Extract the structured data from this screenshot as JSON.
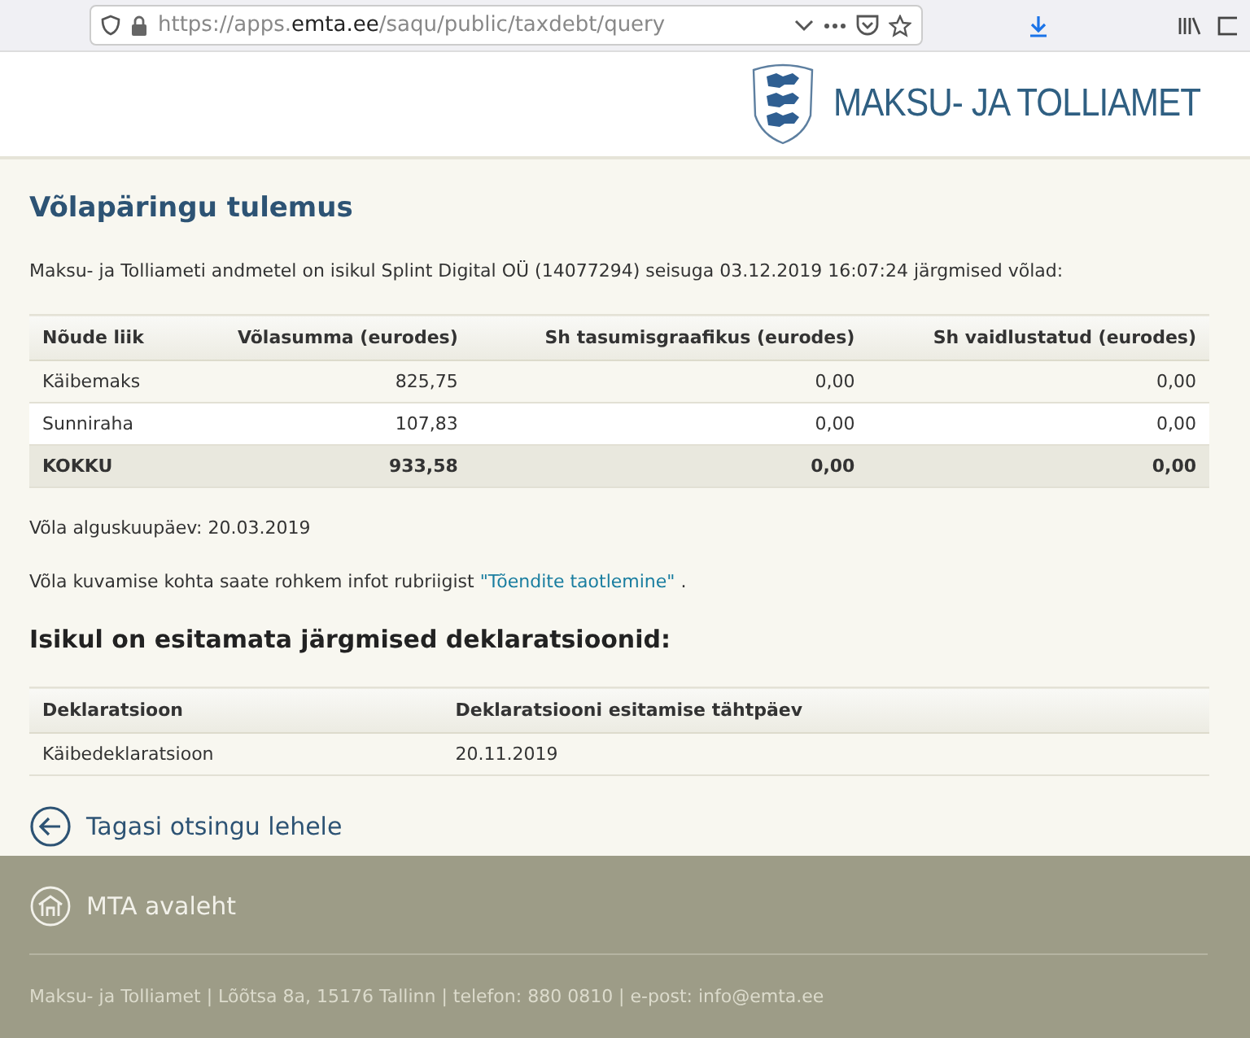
{
  "browser": {
    "url": {
      "prefix": "https://apps.",
      "domain": "emta.ee",
      "path": "/saqu/public/taxdebt/query"
    }
  },
  "header": {
    "logo_text": "MAKSU- JA TOLLIAMET"
  },
  "title": "Võlapäringu tulemus",
  "intro": "Maksu- ja Tolliameti andmetel on isikul Splint Digital OÜ (14077294) seisuga 03.12.2019 16:07:24 järgmised võlad:",
  "debt_table": {
    "columns": [
      "Nõude liik",
      "Võlasumma (eurodes)",
      "Sh tasumisgraafikus (eurodes)",
      "Sh vaidlustatud (eurodes)"
    ],
    "rows": [
      {
        "kind": "item",
        "cells": [
          "Käibemaks",
          "825,75",
          "0,00",
          "0,00"
        ]
      },
      {
        "kind": "item",
        "cells": [
          "Sunniraha",
          "107,83",
          "0,00",
          "0,00"
        ]
      },
      {
        "kind": "total",
        "cells": [
          "KOKKU",
          "933,58",
          "0,00",
          "0,00"
        ]
      }
    ]
  },
  "start_date": "Võla alguskuupäev: 20.03.2019",
  "info": {
    "text": "Võla kuvamise kohta saate rohkem infot rubriigist",
    "link": "\"Tõendite taotlemine\"",
    "end": "."
  },
  "declarations_title": "Isikul on esitamata järgmised deklaratsioonid:",
  "declarations_table": {
    "columns": [
      "Deklaratsioon",
      "Deklaratsiooni esitamise tähtpäev"
    ],
    "rows": [
      [
        "Käibedeklaratsioon",
        "20.11.2019"
      ]
    ]
  },
  "back_link": "Tagasi otsingu lehele",
  "footer": {
    "home_link": "MTA avaleht",
    "contact": "Maksu- ja Tolliamet | Lõõtsa 8a, 15176 Tallinn | telefon: 880 0810 | e-post: info@emta.ee"
  }
}
